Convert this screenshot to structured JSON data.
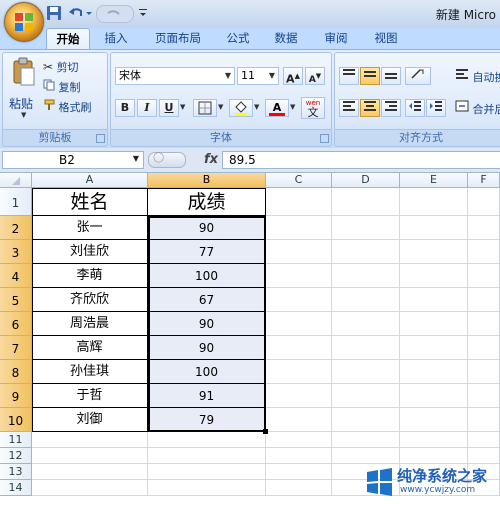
{
  "window": {
    "title": "新建 Micro"
  },
  "tabs": [
    "开始",
    "插入",
    "页面布局",
    "公式",
    "数据",
    "审阅",
    "视图"
  ],
  "active_tab": "开始",
  "ribbon": {
    "clipboard": {
      "paste_label": "粘贴",
      "cut_label": "剪切",
      "copy_label": "复制",
      "format_painter_label": "格式刷",
      "group_label": "剪贴板"
    },
    "font": {
      "font_name": "宋体",
      "font_size": "11",
      "bold": "B",
      "italic": "I",
      "underline": "U",
      "grow": "A",
      "shrink": "A",
      "font_color_letter": "A",
      "phonetic": "wén",
      "phonetic_char": "文",
      "group_label": "字体"
    },
    "alignment": {
      "wrap_text_label": "自动换",
      "merge_label": "合并后",
      "group_label": "对齐方式"
    },
    "colors": {
      "fill_yellow": "#ffff00",
      "font_red": "#ff0000"
    }
  },
  "formula_bar": {
    "cell_ref": "B2",
    "fx_label": "fx",
    "formula_value": "89.5"
  },
  "sheet": {
    "columns": [
      "A",
      "B",
      "C",
      "D",
      "E",
      "F"
    ],
    "selected_column": "B",
    "rows": [
      "1",
      "2",
      "3",
      "4",
      "5",
      "6",
      "7",
      "8",
      "9",
      "10",
      "11",
      "12",
      "13",
      "14"
    ],
    "header": {
      "name": "姓名",
      "score": "成绩"
    },
    "data": [
      {
        "name": "张一",
        "score": "90"
      },
      {
        "name": "刘佳欣",
        "score": "77"
      },
      {
        "name": "李萌",
        "score": "100"
      },
      {
        "name": "齐欣欣",
        "score": "67"
      },
      {
        "name": "周浩晨",
        "score": "90"
      },
      {
        "name": "高辉",
        "score": "90"
      },
      {
        "name": "孙佳琪",
        "score": "100"
      },
      {
        "name": "于哲",
        "score": "91"
      },
      {
        "name": "刘御",
        "score": "79"
      }
    ]
  },
  "watermark": {
    "brand": "纯净系统之家",
    "url": "www.ycwjzy.com"
  }
}
